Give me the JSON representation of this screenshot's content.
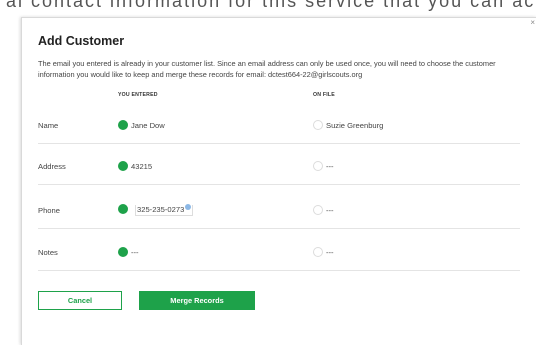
{
  "background_text": "al contact information for this service that you can activate at your convenience later",
  "dialog": {
    "title": "Add Customer",
    "close_glyph": "×",
    "description": "The email you entered is already in your customer list. Since an email address can only be used once, you will need to choose the customer information you would like to keep and merge these records for email: dctest664-22@girlscouts.org",
    "col_entered": "YOU ENTERED",
    "col_onfile": "ON FILE",
    "rows": [
      {
        "label": "Name",
        "entered": "Jane Dow",
        "onfile": "Suzie Greenburg",
        "selected": "entered"
      },
      {
        "label": "Address",
        "entered": "43215",
        "onfile": "---",
        "selected": "entered"
      },
      {
        "label": "Phone",
        "entered": "325-235-0273",
        "onfile": "---",
        "selected": "entered"
      },
      {
        "label": "Notes",
        "entered": "---",
        "onfile": "---",
        "selected": "entered"
      }
    ],
    "cancel_label": "Cancel",
    "merge_label": "Merge Records"
  },
  "colors": {
    "accent": "#1ea24a"
  }
}
